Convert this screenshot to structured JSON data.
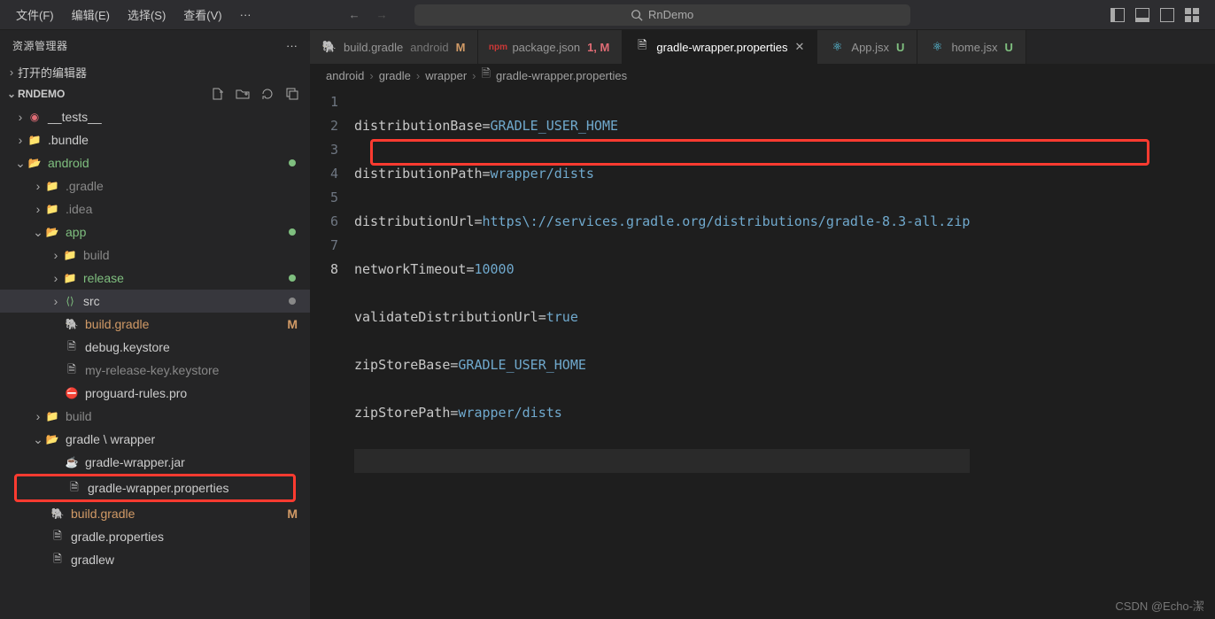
{
  "menubar": {
    "items": [
      "文件(F)",
      "编辑(E)",
      "选择(S)",
      "查看(V)"
    ],
    "ellipsis": "···"
  },
  "search": {
    "placeholder": "RnDemo"
  },
  "sidebar": {
    "title": "资源管理器",
    "open_editors": "打开的编辑器",
    "project": "RNDEMO"
  },
  "tree": {
    "tests": "__tests__",
    "bundle": ".bundle",
    "android": "android",
    "gradle_dot": ".gradle",
    "idea": ".idea",
    "app": "app",
    "build": "build",
    "release": "release",
    "src": "src",
    "build_gradle": "build.gradle",
    "build_gradle_badge": "M",
    "debug_keystore": "debug.keystore",
    "my_release_key": "my-release-key.keystore",
    "proguard": "proguard-rules.pro",
    "build2": "build",
    "gradle_wrapper": "gradle \\ wrapper",
    "gradle_wrapper_jar": "gradle-wrapper.jar",
    "gradle_wrapper_props": "gradle-wrapper.properties",
    "build_gradle2": "build.gradle",
    "build_gradle2_badge": "M",
    "gradle_properties": "gradle.properties",
    "gradlew": "gradlew"
  },
  "tabs": [
    {
      "icon": "elephant",
      "label": "build.gradle",
      "sub": "android",
      "status": "M",
      "status_class": "m"
    },
    {
      "icon": "npm",
      "label": "package.json",
      "sub": "",
      "status": "1, M",
      "status_class": "red"
    },
    {
      "icon": "file",
      "label": "gradle-wrapper.properties",
      "active": true,
      "close": true
    },
    {
      "icon": "react",
      "label": "App.jsx",
      "status": "U",
      "status_class": "u"
    },
    {
      "icon": "react",
      "label": "home.jsx",
      "status": "U",
      "status_class": "u"
    }
  ],
  "breadcrumb": [
    "android",
    "gradle",
    "wrapper",
    "gradle-wrapper.properties"
  ],
  "code": {
    "lines": [
      {
        "n": "1",
        "key": "distributionBase",
        "val": "GRADLE_USER_HOME"
      },
      {
        "n": "2",
        "key": "distributionPath",
        "val": "wrapper/dists"
      },
      {
        "n": "3",
        "key": "distributionUrl",
        "val": "https\\://services.gradle.org/distributions/gradle-8.3-all.zip"
      },
      {
        "n": "4",
        "key": "networkTimeout",
        "val": "10000"
      },
      {
        "n": "5",
        "key": "validateDistributionUrl",
        "val": "true"
      },
      {
        "n": "6",
        "key": "zipStoreBase",
        "val": "GRADLE_USER_HOME"
      },
      {
        "n": "7",
        "key": "zipStorePath",
        "val": "wrapper/dists"
      },
      {
        "n": "8",
        "key": "",
        "val": ""
      }
    ]
  },
  "watermark": "CSDN @Echo-潔"
}
